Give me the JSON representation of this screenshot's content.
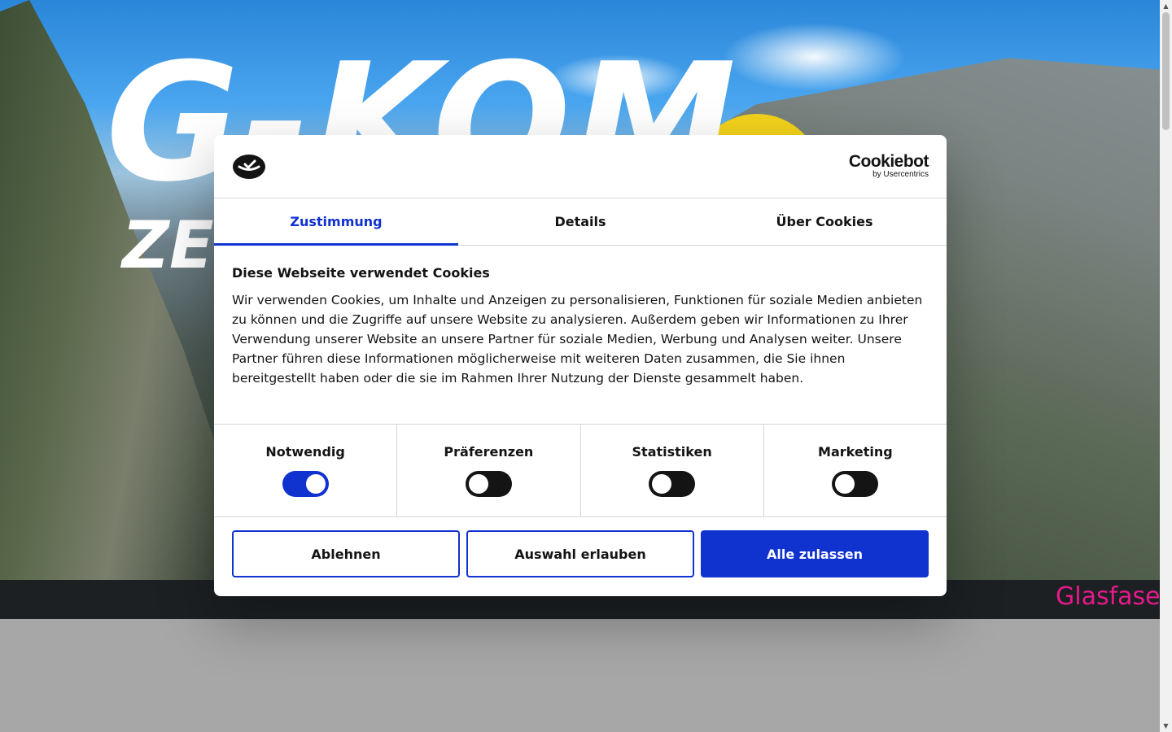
{
  "background": {
    "hero_logo": "G-KOM",
    "hero_sub": "ZE",
    "ticker_text": "Glasfase"
  },
  "cookie_dialog": {
    "brand_name": "Cookiebot",
    "brand_by": "by Usercentrics",
    "tabs": [
      {
        "label": "Zustimmung",
        "active": true
      },
      {
        "label": "Details",
        "active": false
      },
      {
        "label": "Über Cookies",
        "active": false
      }
    ],
    "heading": "Diese Webseite verwendet Cookies",
    "text": "Wir verwenden Cookies, um Inhalte und Anzeigen zu personalisieren, Funktionen für soziale Medien anbieten zu können und die Zugriffe auf unsere Website zu analysieren. Außerdem geben wir Informationen zu Ihrer Verwendung unserer Website an unsere Partner für soziale Medien, Werbung und Analysen weiter. Unsere Partner führen diese Informationen möglicherweise mit weiteren Daten zusammen, die Sie ihnen bereitgestellt haben oder die sie im Rahmen Ihrer Nutzung der Dienste gesammelt haben.",
    "categories": [
      {
        "label": "Notwendig",
        "enabled": true
      },
      {
        "label": "Präferenzen",
        "enabled": false
      },
      {
        "label": "Statistiken",
        "enabled": false
      },
      {
        "label": "Marketing",
        "enabled": false
      }
    ],
    "buttons": {
      "decline": "Ablehnen",
      "allow_selection": "Auswahl erlauben",
      "allow_all": "Alle zulassen"
    }
  },
  "colors": {
    "accent": "#1032cf",
    "ticker": "#e6198b",
    "dark_bar": "#1d2023"
  }
}
